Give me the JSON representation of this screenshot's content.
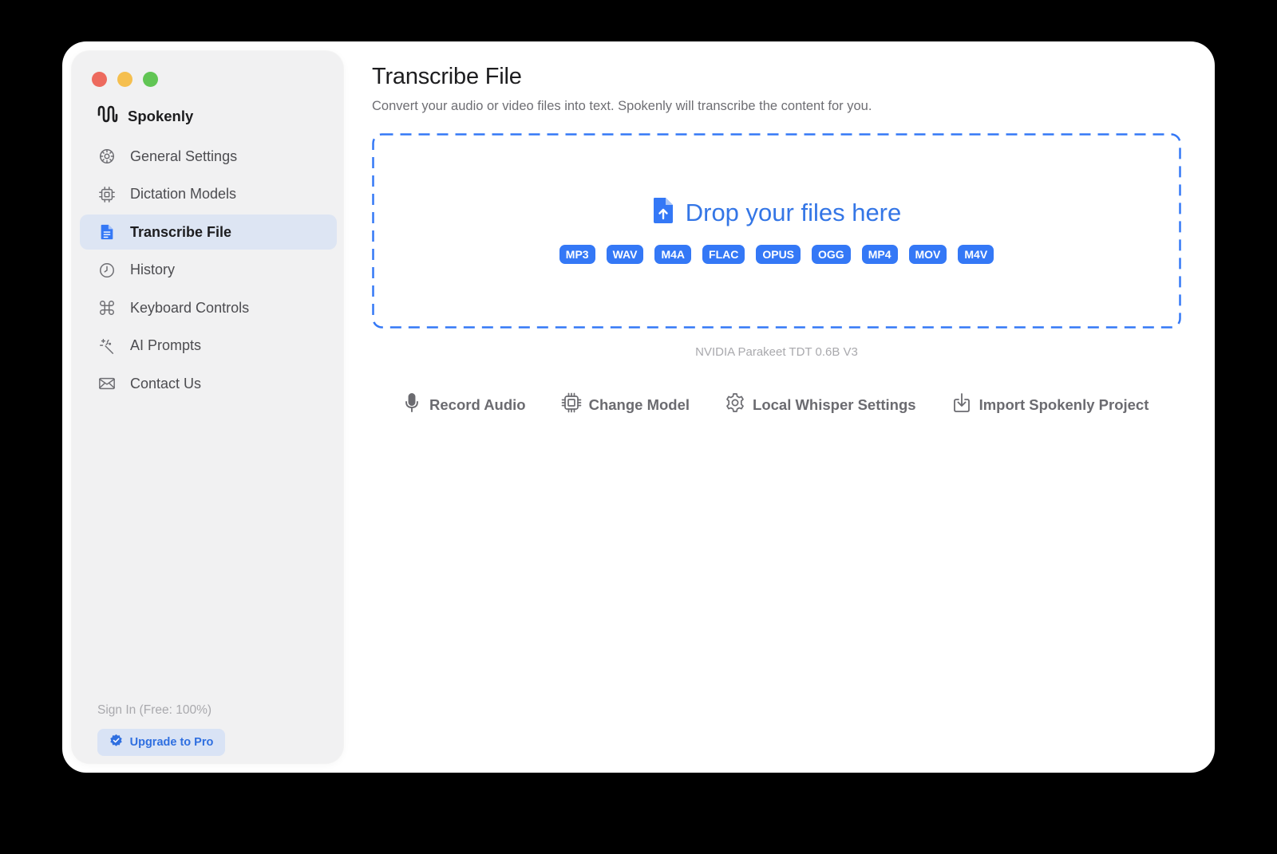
{
  "app": {
    "name": "Spokenly"
  },
  "window_controls": [
    "close",
    "minimize",
    "zoom"
  ],
  "sidebar": {
    "items": [
      {
        "label": "General Settings",
        "icon": "gear-icon"
      },
      {
        "label": "Dictation Models",
        "icon": "chip-icon"
      },
      {
        "label": "Transcribe File",
        "icon": "document-icon",
        "active": true
      },
      {
        "label": "History",
        "icon": "clock-icon"
      },
      {
        "label": "Keyboard Controls",
        "icon": "command-icon"
      },
      {
        "label": "AI Prompts",
        "icon": "magic-wand-icon"
      },
      {
        "label": "Contact Us",
        "icon": "envelope-icon"
      }
    ],
    "sign_in_label": "Sign In (Free: 100%)",
    "upgrade_label": "Upgrade to Pro"
  },
  "main": {
    "title": "Transcribe File",
    "subtitle": "Convert your audio or video files into text. Spokenly will transcribe the content for you.",
    "dropzone": {
      "title": "Drop your files here",
      "formats": [
        "MP3",
        "WAV",
        "M4A",
        "FLAC",
        "OPUS",
        "OGG",
        "MP4",
        "MOV",
        "M4V"
      ]
    },
    "model_name": "NVIDIA Parakeet TDT 0.6B V3",
    "actions": [
      {
        "label": "Record Audio",
        "icon": "microphone-icon"
      },
      {
        "label": "Change Model",
        "icon": "chip-icon"
      },
      {
        "label": "Local Whisper Settings",
        "icon": "gear-icon"
      },
      {
        "label": "Import Spokenly Project",
        "icon": "import-icon"
      }
    ]
  },
  "colors": {
    "accent": "#3478f6",
    "sidebar_bg": "#f1f1f2",
    "active_item_bg": "#dde5f3",
    "window_bg": "#ffffff",
    "backdrop": "#000000"
  }
}
